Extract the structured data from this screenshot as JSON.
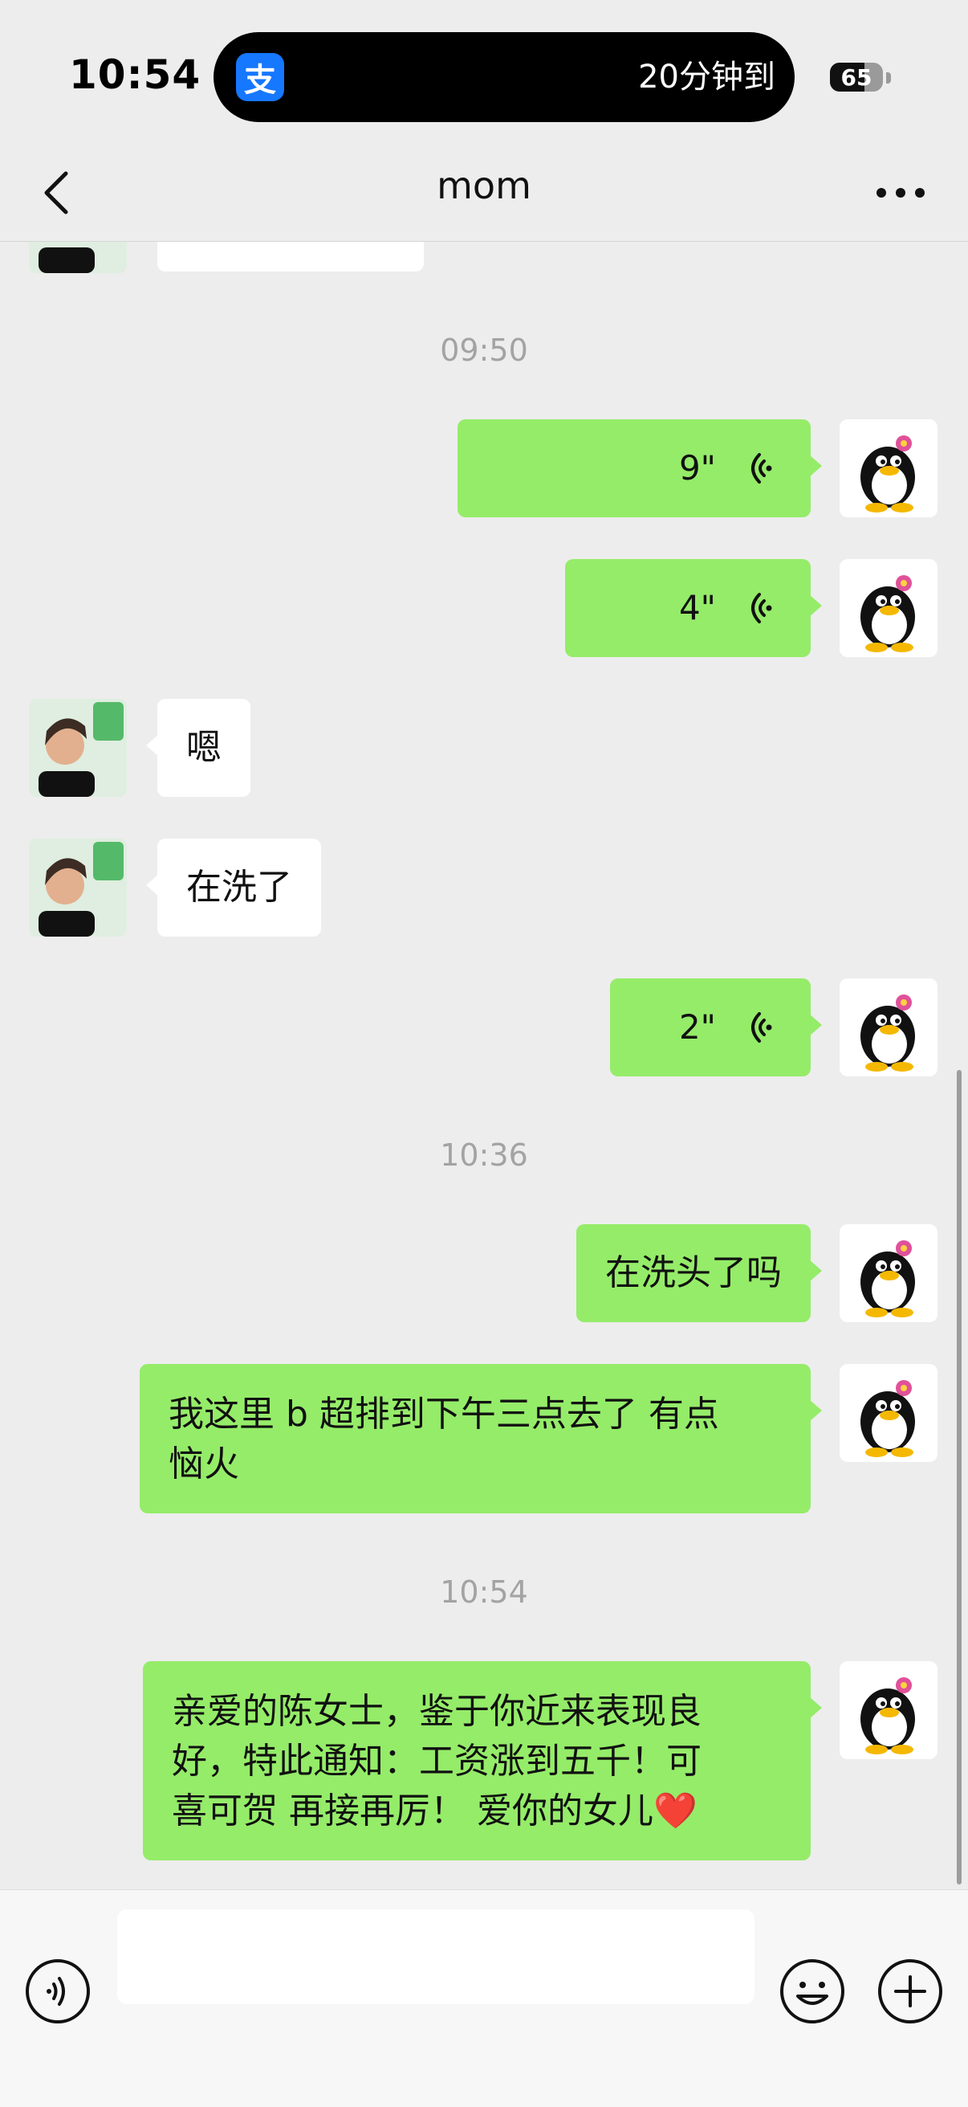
{
  "status_bar": {
    "time": "10:54",
    "app_badge": "支",
    "live_activity_text": "20分钟到",
    "battery_percent": 65,
    "battery_label": "65"
  },
  "header": {
    "title": "mom",
    "back_icon": "chevron-left-icon",
    "more_icon": "ellipsis-icon"
  },
  "chat": {
    "timestamps": [
      "09:50",
      "10:36",
      "10:54"
    ],
    "messages": [
      {
        "sender": "mom",
        "type": "image",
        "partial": true
      },
      {
        "sender": "me",
        "type": "voice",
        "duration": "9\""
      },
      {
        "sender": "me",
        "type": "voice",
        "duration": "4\""
      },
      {
        "sender": "mom",
        "type": "text",
        "text": "嗯"
      },
      {
        "sender": "mom",
        "type": "text",
        "text": "在洗了"
      },
      {
        "sender": "me",
        "type": "voice",
        "duration": "2\""
      },
      {
        "sender": "me",
        "type": "text",
        "text": "在洗头了吗"
      },
      {
        "sender": "me",
        "type": "text",
        "text": "我这里 b 超排到下午三点去了 有点\n恼火"
      },
      {
        "sender": "me",
        "type": "text",
        "text": "亲爱的陈女士，鉴于你近来表现良\n好，特此通知：工资涨到五千！可\n喜可贺 再接再厉！ 爱你的女儿❤️"
      }
    ]
  },
  "input_bar": {
    "placeholder": "",
    "voice_icon": "voice-toggle-icon",
    "emoji_icon": "emoji-icon",
    "plus_icon": "plus-icon"
  },
  "colors": {
    "background": "#ededed",
    "my_bubble": "#95ec69",
    "other_bubble": "#ffffff",
    "timestamp": "#a3a3a3",
    "alipay_blue": "#1677ff"
  }
}
